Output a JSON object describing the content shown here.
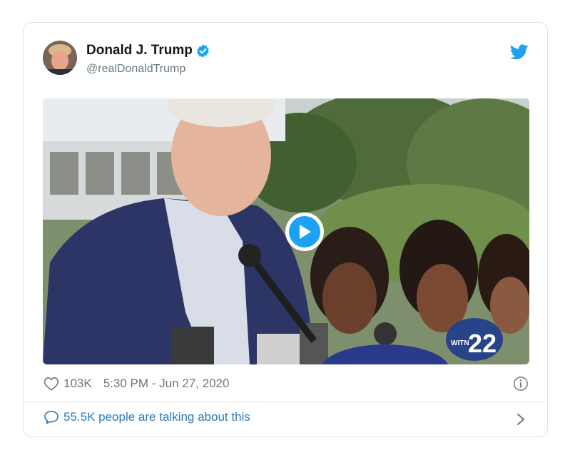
{
  "tweet": {
    "author_name": "Donald J. Trump",
    "author_handle": "@realDonaldTrump",
    "verified": true,
    "likes": "103K",
    "timestamp": "5:30 PM - Jun 27, 2020",
    "talking": "55.5K people are talking about this"
  },
  "media": {
    "type": "video",
    "channel_bug_prefix": "WITN",
    "channel_bug_number": "22"
  },
  "icons": {
    "verified": "verified-badge-icon",
    "brand": "twitter-bird-icon",
    "like": "heart-icon",
    "info": "info-icon",
    "reply": "speech-bubble-icon",
    "more": "chevron-right-icon",
    "play": "play-icon"
  },
  "colors": {
    "accent": "#1da1f2",
    "link": "#2b7bb9",
    "muted": "#697882",
    "text": "#14171a",
    "border": "#dfe3e7"
  }
}
